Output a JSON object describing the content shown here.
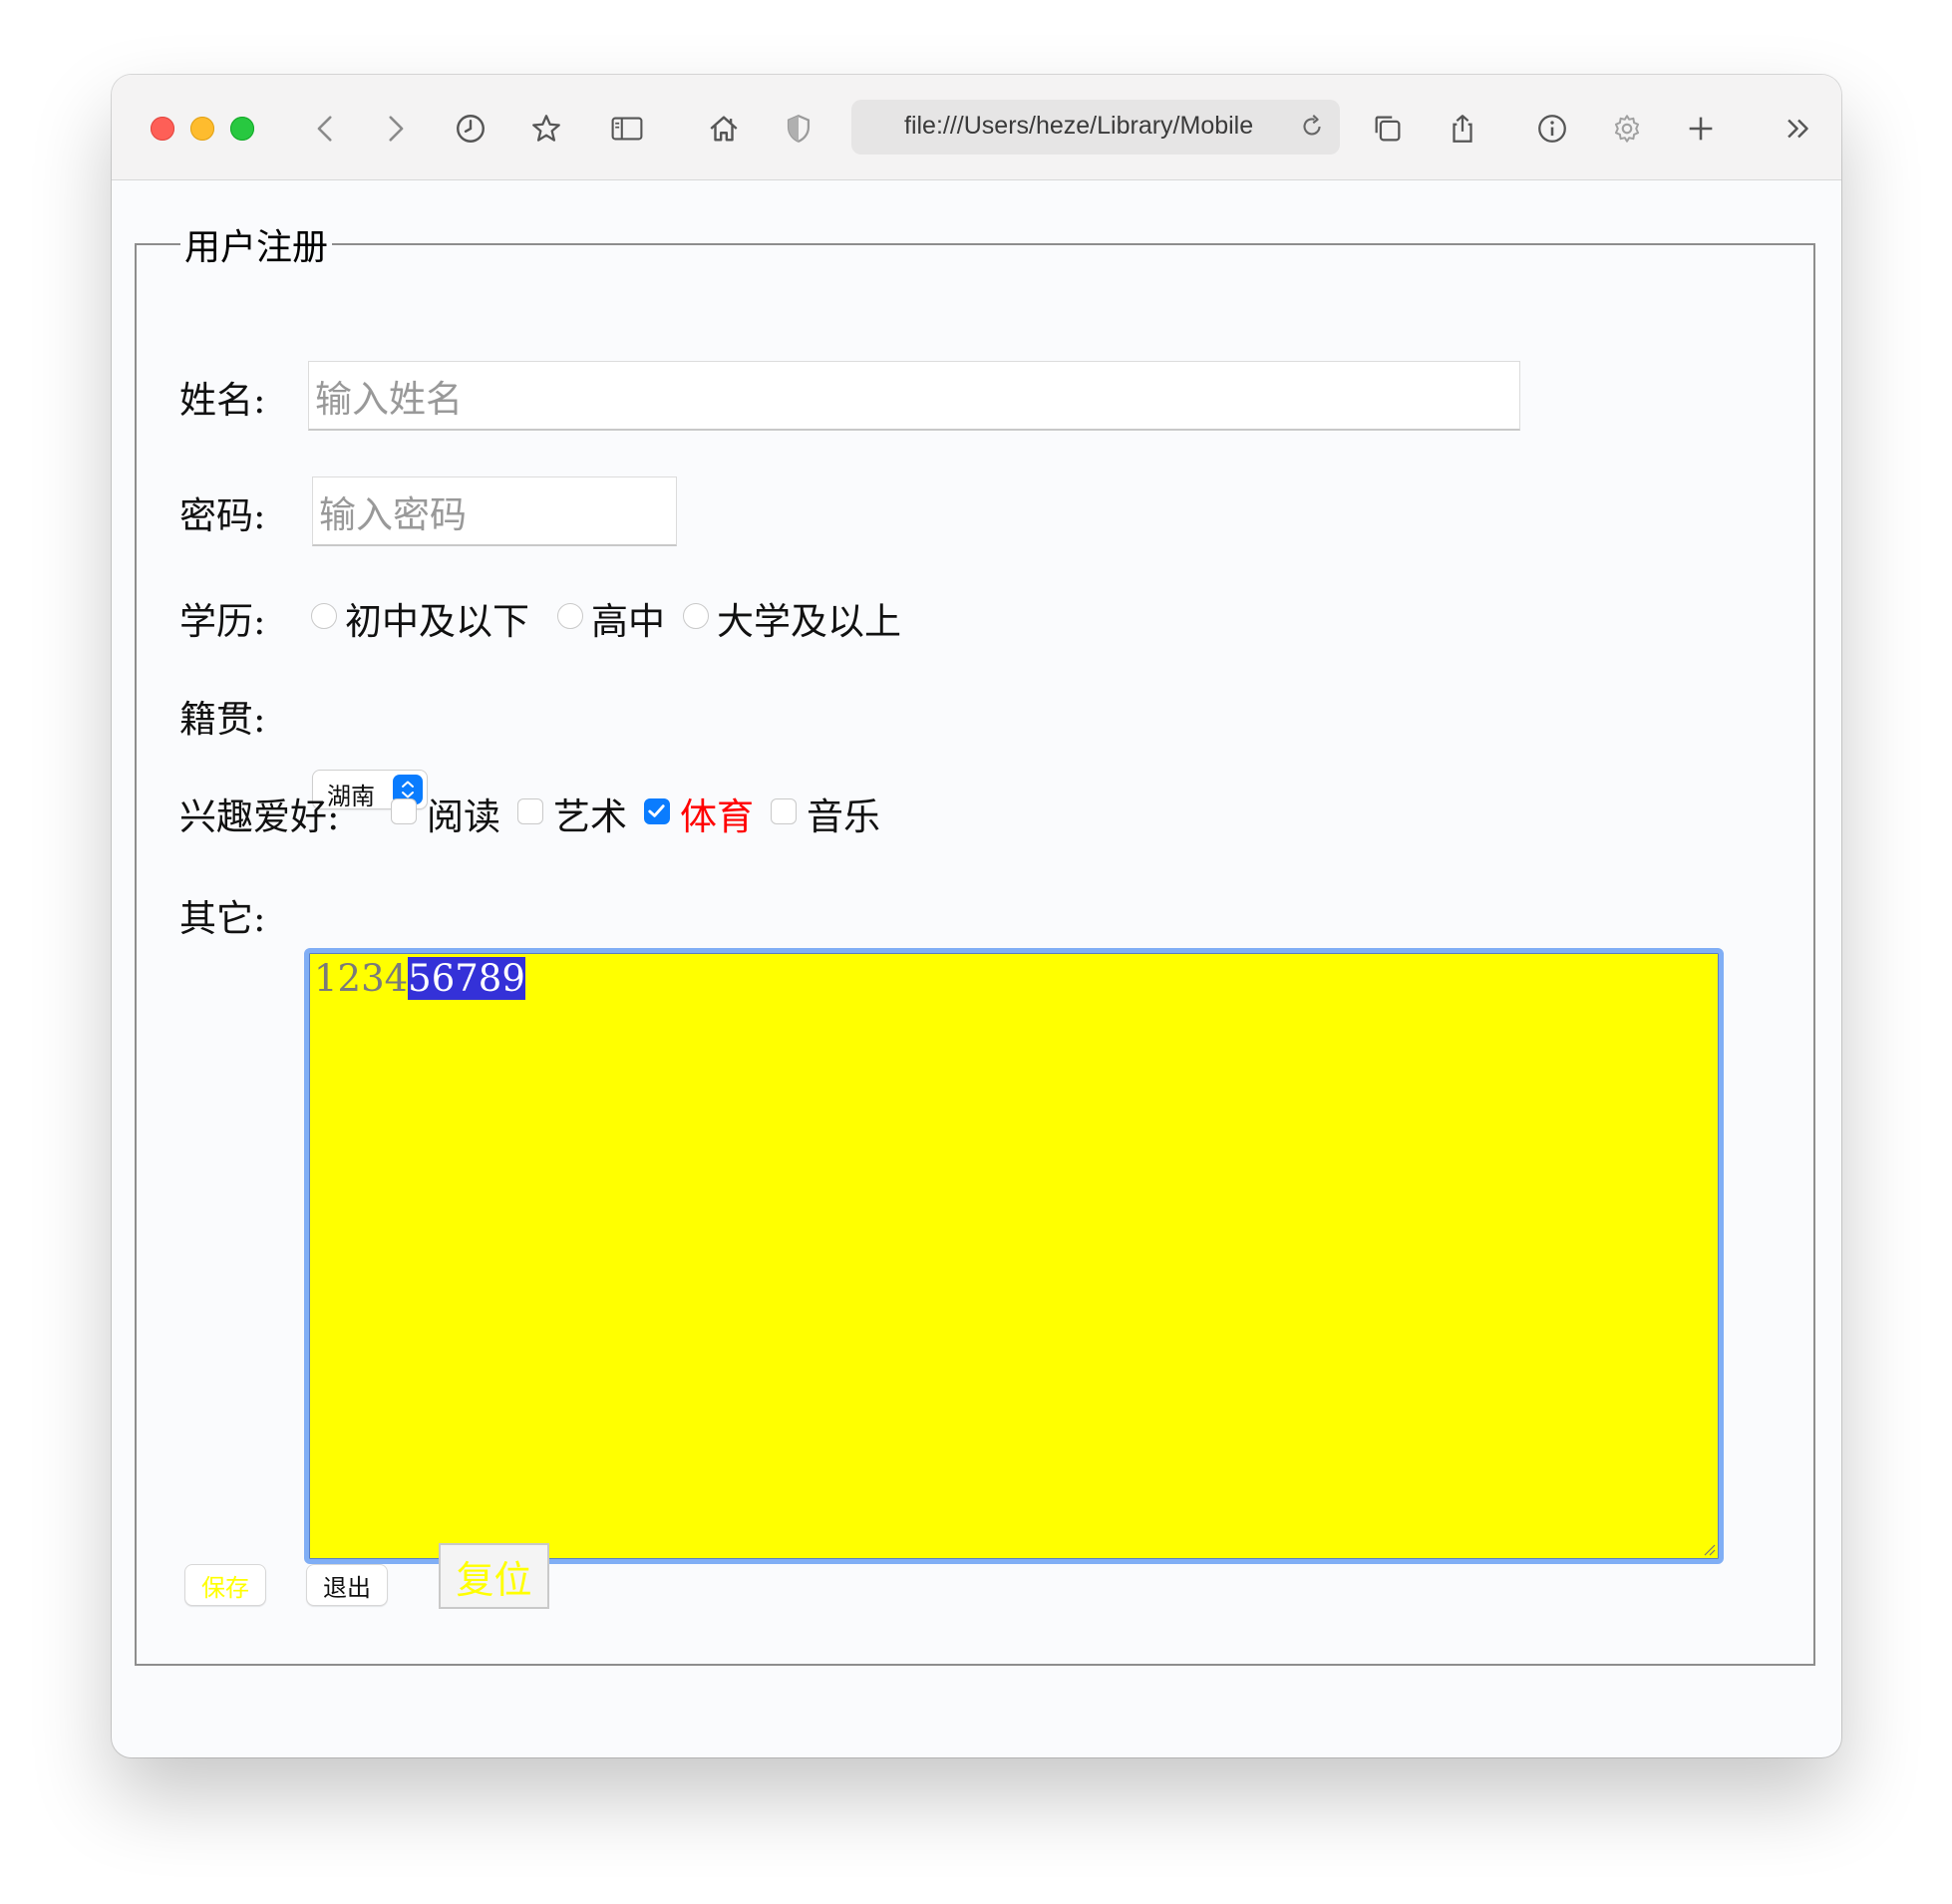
{
  "browser": {
    "url": "file:///Users/heze/Library/Mobile",
    "icons": [
      "back-icon",
      "forward-icon",
      "history-icon",
      "bookmark-star-icon",
      "sidebar-icon",
      "home-icon",
      "shield-icon",
      "reload-icon",
      "tabs-overview-icon",
      "share-icon",
      "info-icon",
      "settings-gear-icon",
      "new-tab-icon",
      "more-chevrons-icon"
    ]
  },
  "form": {
    "legend": "用户注册",
    "name_label": "姓名:",
    "name_placeholder": "输入姓名",
    "password_label": "密码:",
    "password_placeholder": "输入密码",
    "education_label": "学历:",
    "education_options": [
      {
        "label": "初中及以下",
        "checked": false
      },
      {
        "label": "高中",
        "checked": false
      },
      {
        "label": "大学及以上",
        "checked": false
      }
    ],
    "hometown_label": "籍贯:",
    "hometown_selected": "湖南",
    "hobbies_label": "兴趣爱好:",
    "hobbies": [
      {
        "label": "阅读",
        "checked": false
      },
      {
        "label": "艺术",
        "checked": false
      },
      {
        "label": "体育",
        "checked": true,
        "color": "#ff0000"
      },
      {
        "label": "音乐",
        "checked": false
      }
    ],
    "other_label": "其它:",
    "other_value_unselected": "1234",
    "other_value_selected": "56789",
    "textarea_bg": "#ffff00",
    "selection_color": "#3431d8",
    "buttons": {
      "save": "保存",
      "exit": "退出",
      "reset": "复位"
    },
    "save_color": "#ffff00",
    "reset_color": "#ffff00"
  }
}
